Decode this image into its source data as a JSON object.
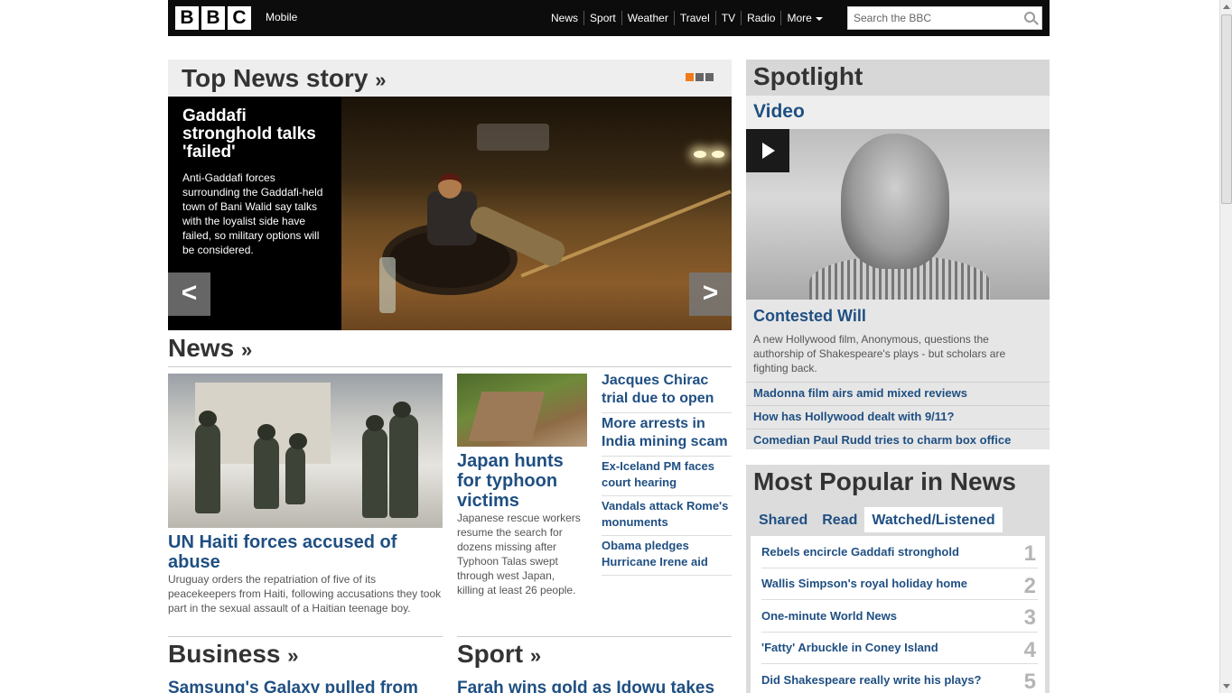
{
  "header": {
    "logo_letters": [
      "B",
      "B",
      "C"
    ],
    "mobile_label": "Mobile",
    "nav": [
      "News",
      "Sport",
      "Weather",
      "Travel",
      "TV",
      "Radio"
    ],
    "more_label": "More",
    "search_placeholder": "Search the BBC"
  },
  "top_news": {
    "title": "Top News story",
    "raquo": "»",
    "headline": "Gaddafi stronghold talks 'failed'",
    "summary": "Anti-Gaddafi forces surrounding the Gaddafi-held town of Bani Walid say talks with the loyalist side have failed, so military options will be considered.",
    "prev_label": "<",
    "next_label": ">",
    "pager_total": 3,
    "pager_active": 1
  },
  "news": {
    "title": "News",
    "main_story": {
      "headline": "UN Haiti forces accused of abuse",
      "summary": "Uruguay orders the repatriation of five of its peacekeepers from Haiti, following accusations they took part in the sexual assault of a Haitian teenage boy."
    },
    "second_story": {
      "headline": "Japan hunts for typhoon victims",
      "summary": "Japanese rescue workers resume the search for dozens missing after Typhoon Talas swept through west Japan, killing at least 26 people."
    },
    "more_stories": [
      "Jacques Chirac trial due to open",
      "More arrests in India mining scam",
      "Ex-Iceland PM faces court hearing",
      "Vandals attack Rome's monuments",
      "Obama pledges Hurricane Irene aid"
    ]
  },
  "business": {
    "title": "Business",
    "top_link": "Samsung's Galaxy pulled from"
  },
  "sport": {
    "title": "Sport",
    "top_link": "Farah wins gold as Idowu takes"
  },
  "spotlight": {
    "title": "Spotlight",
    "subtitle": "Video",
    "feature_headline": "Contested Will",
    "feature_summary": "A new Hollywood film, Anonymous, questions the authorship of Shakespeare's plays - but scholars are fighting back.",
    "links": [
      "Madonna film airs amid mixed reviews",
      "How has Hollywood dealt with 9/11?",
      "Comedian Paul Rudd tries to charm box office"
    ]
  },
  "most_popular": {
    "title": "Most Popular in News",
    "tabs": [
      "Shared",
      "Read",
      "Watched/Listened"
    ],
    "active_tab": "Watched/Listened",
    "items": [
      {
        "rank": "1",
        "title": "Rebels encircle Gaddafi stronghold"
      },
      {
        "rank": "2",
        "title": "Wallis Simpson's royal holiday home"
      },
      {
        "rank": "3",
        "title": "One-minute World News"
      },
      {
        "rank": "4",
        "title": "'Fatty' Arbuckle in Coney Island"
      },
      {
        "rank": "5",
        "title": "Did Shakespeare really write his plays?"
      }
    ]
  },
  "colors": {
    "link": "#1f4f82",
    "accent": "#f17a1c",
    "topbar": "#0c0c0c"
  }
}
